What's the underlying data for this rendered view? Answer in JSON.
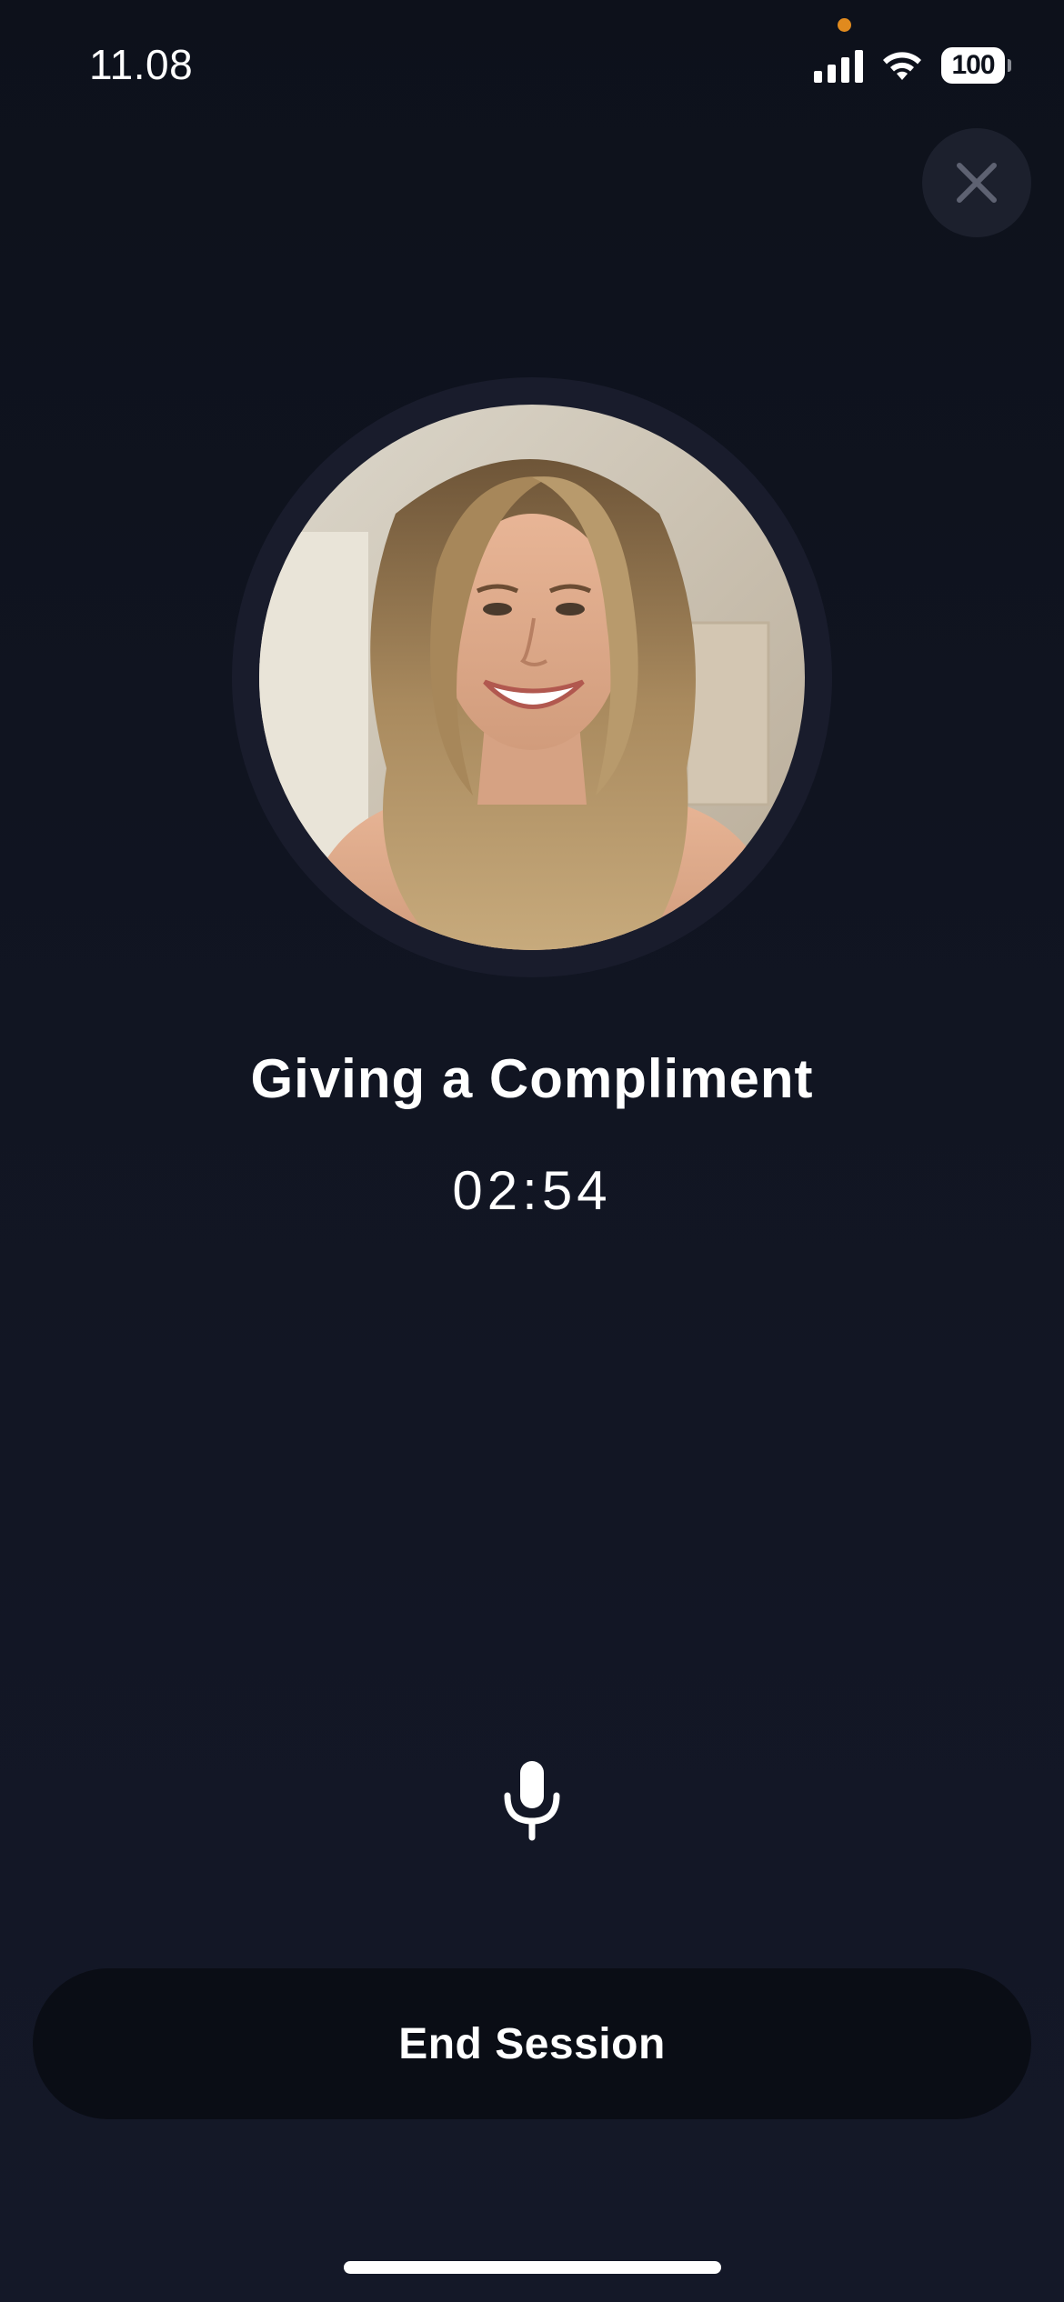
{
  "status_bar": {
    "time": "11.08",
    "battery": "100",
    "signal_icon": "cellular-signal-icon",
    "wifi_icon": "wifi-icon",
    "privacy_dot_color": "#e08a1e"
  },
  "close_button": {
    "icon": "close-icon"
  },
  "avatar": {
    "description_icon": "profile-photo"
  },
  "session": {
    "title": "Giving a Compliment",
    "timer": "02:54"
  },
  "mic": {
    "icon": "microphone-icon"
  },
  "end_button": {
    "label": "End Session"
  },
  "colors": {
    "background": "#111522",
    "button_background": "#0a0d15",
    "close_background": "#1c202d",
    "avatar_ring": "#191c2c"
  }
}
